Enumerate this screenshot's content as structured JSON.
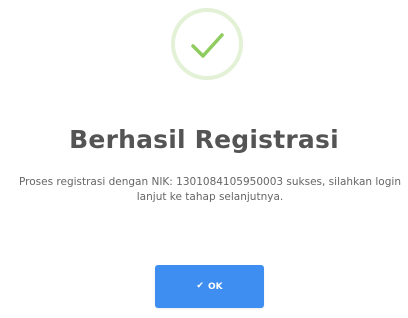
{
  "dialog": {
    "icon": "check-icon",
    "icon_color": "#8fcc60",
    "title": "Berhasil Registrasi",
    "message": "Proses registrasi dengan NIK: 1301084105950003 sukses, silahkan login lanjut ke tahap selanjutnya.",
    "ok_button_label": "OK",
    "ok_button_icon": "check-icon",
    "ok_button_color": "#3d8ef0"
  }
}
